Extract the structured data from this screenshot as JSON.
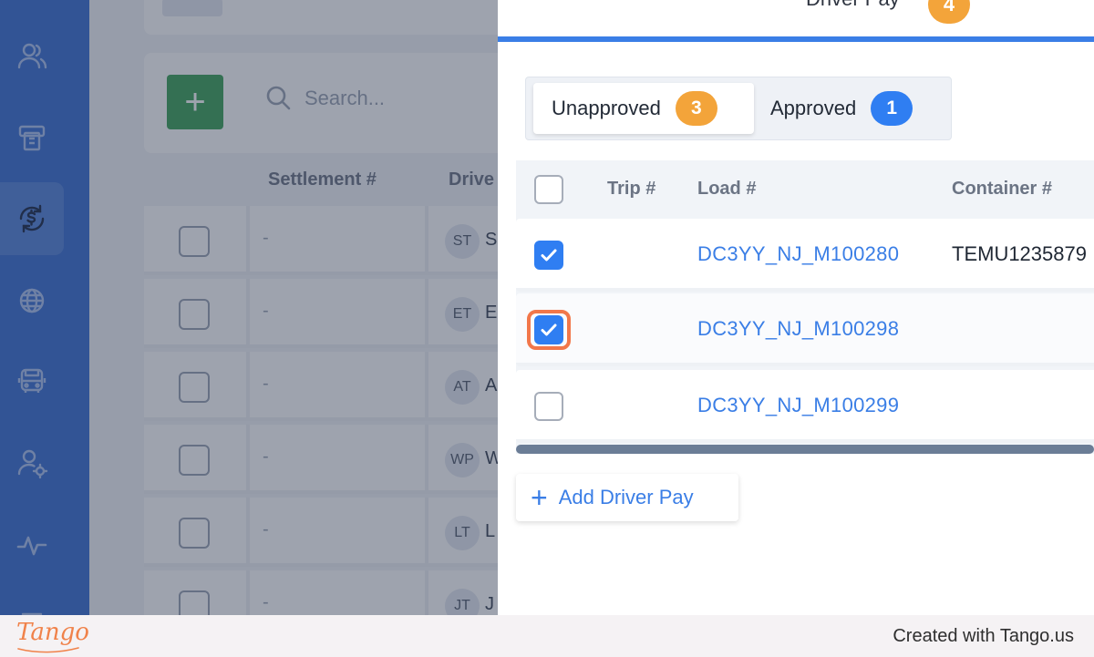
{
  "background_page": {
    "search_placeholder": "Search...",
    "columns": [
      "Settlement #",
      "Drive"
    ],
    "rows": [
      {
        "settlement": "-",
        "initials": "ST",
        "name_prefix": "S"
      },
      {
        "settlement": "-",
        "initials": "ET",
        "name_prefix": "E"
      },
      {
        "settlement": "-",
        "initials": "AT",
        "name_prefix": "A"
      },
      {
        "settlement": "-",
        "initials": "WP",
        "name_prefix": "W"
      },
      {
        "settlement": "-",
        "initials": "LT",
        "name_prefix": "L"
      },
      {
        "settlement": "-",
        "initials": "JT",
        "name_prefix": "J"
      }
    ]
  },
  "panel": {
    "tab_label": "Driver Pay",
    "tab_count": "4",
    "segments": [
      {
        "label": "Unapproved",
        "count": "3",
        "active": true
      },
      {
        "label": "Approved",
        "count": "1",
        "active": false
      }
    ],
    "columns": [
      "Trip #",
      "Load #",
      "Container #"
    ],
    "rows": [
      {
        "trip": "",
        "load": "DC3YY_NJ_M100280",
        "container": "TEMU1235879",
        "checked": true
      },
      {
        "trip": "",
        "load": "DC3YY_NJ_M100298",
        "container": "",
        "checked": true
      },
      {
        "trip": "",
        "load": "DC3YY_NJ_M100299",
        "container": "",
        "checked": false
      }
    ],
    "add_button_label": "Add Driver Pay"
  },
  "footer": {
    "logo_text": "Tango",
    "credit": "Created with Tango.us"
  },
  "colors": {
    "sidebar": "#3b6fd1",
    "accent_blue": "#3a7ee6",
    "badge_orange": "#f3a43a",
    "add_green": "#3fa35a",
    "highlight": "#f2774a"
  }
}
